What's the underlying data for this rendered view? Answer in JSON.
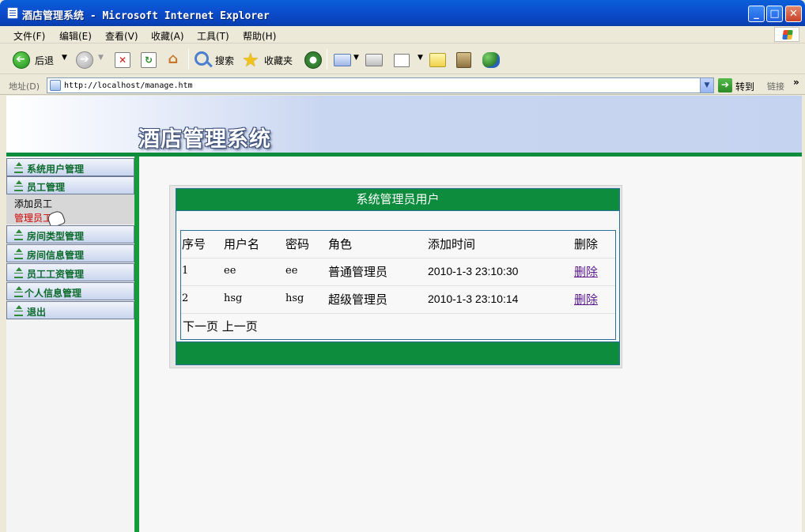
{
  "window": {
    "title": "酒店管理系统 - Microsoft Internet Explorer",
    "min_symbol": "_",
    "max_symbol": "□",
    "close_symbol": "✕"
  },
  "menu": [
    "文件(F)",
    "编辑(E)",
    "查看(V)",
    "收藏(A)",
    "工具(T)",
    "帮助(H)"
  ],
  "toolbar": {
    "back_label": "后退",
    "search_label": "搜索",
    "favorites_label": "收藏夹"
  },
  "address": {
    "label": "地址(D)",
    "url": "http://localhost/manage.htm",
    "go_label": "转到",
    "links_label": "链接"
  },
  "page": {
    "banner_title": "酒店管理系统",
    "sidebar": [
      {
        "label": "系统用户管理"
      },
      {
        "label": "员工管理"
      },
      {
        "label": "房间类型管理"
      },
      {
        "label": "房间信息管理"
      },
      {
        "label": "员工工资管理"
      },
      {
        "label": "个人信息管理"
      },
      {
        "label": "退出"
      }
    ],
    "sidebar_sub": {
      "add_employee": "添加员工",
      "manage_employee": "管理员工"
    },
    "panel": {
      "title": "系统管理员用户",
      "headers": {
        "index": "序号",
        "username": "用户名",
        "password": "密码",
        "role": "角色",
        "added": "添加时间",
        "delete": "删除"
      },
      "rows": [
        {
          "index": "1",
          "username": "ee",
          "password": "ee",
          "role": "普通管理员",
          "added": "2010-1-3 23:10:30",
          "delete": "删除"
        },
        {
          "index": "2",
          "username": "hsg",
          "password": "hsg",
          "role": "超级管理员",
          "added": "2010-1-3 23:10:14",
          "delete": "删除"
        }
      ],
      "pager": {
        "next": "下一页",
        "prev": "上一页"
      }
    }
  },
  "colors": {
    "accent_green": "#0c8c3c",
    "sidebar_text": "#0d6b2c",
    "active_sub": "#d40000",
    "link_visited": "#5a1a8c"
  }
}
